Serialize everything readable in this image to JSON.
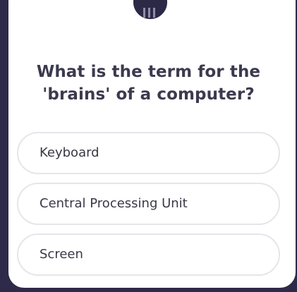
{
  "quiz": {
    "question": "What is the term for the 'brains' of a computer?",
    "options": [
      {
        "label": "Keyboard"
      },
      {
        "label": "Central Processing Unit"
      },
      {
        "label": "Screen"
      }
    ]
  },
  "colors": {
    "background": "#2e2a4a",
    "card": "#ffffff",
    "text": "#3c3a4e",
    "option_border": "#e6e5ea"
  },
  "icons": {
    "top_avatar": "avatar-icon"
  }
}
